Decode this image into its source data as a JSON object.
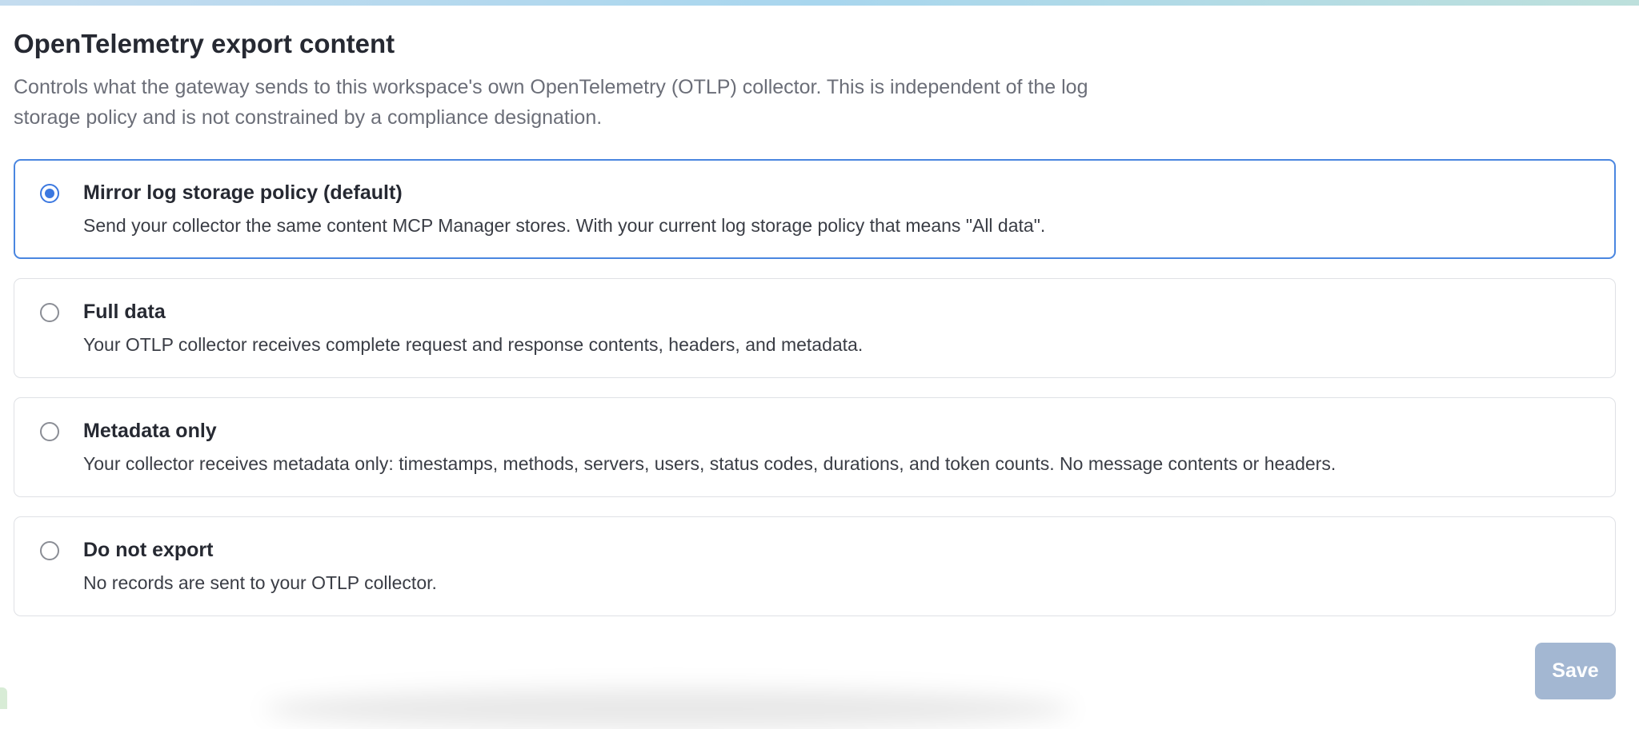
{
  "section": {
    "title": "OpenTelemetry export content",
    "description": "Controls what the gateway sends to this workspace's own OpenTelemetry (OTLP) collector. This is independent of the log storage policy and is not constrained by a compliance designation."
  },
  "options": [
    {
      "title": "Mirror log storage policy (default)",
      "description": "Send your collector the same content MCP Manager stores. With your current log storage policy that means \"All data\".",
      "selected": true
    },
    {
      "title": "Full data",
      "description": "Your OTLP collector receives complete request and response contents, headers, and metadata.",
      "selected": false
    },
    {
      "title": "Metadata only",
      "description": "Your collector receives metadata only: timestamps, methods, servers, users, status codes, durations, and token counts. No message contents or headers.",
      "selected": false
    },
    {
      "title": "Do not export",
      "description": "No records are sent to your OTLP collector.",
      "selected": false
    }
  ],
  "actions": {
    "save_label": "Save"
  },
  "colors": {
    "accent": "#3b78e0",
    "selected_border": "#4a86e0",
    "save_disabled": "#a3b7d2"
  }
}
